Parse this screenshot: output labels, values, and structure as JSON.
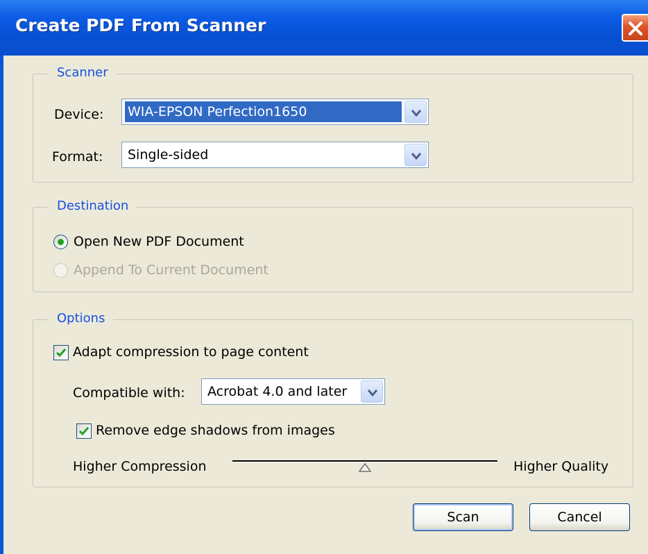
{
  "window": {
    "title": "Create PDF From Scanner"
  },
  "scanner": {
    "legend": "Scanner",
    "device_label": "Device:",
    "device_value": "WIA-EPSON Perfection1650",
    "format_label": "Format:",
    "format_value": "Single-sided"
  },
  "destination": {
    "legend": "Destination",
    "open_new_label": "Open New PDF Document",
    "open_new_selected": true,
    "append_label": "Append To Current Document",
    "append_enabled": false
  },
  "options": {
    "legend": "Options",
    "adapt_compression_label": "Adapt compression to page content",
    "adapt_compression_checked": true,
    "compatible_label": "Compatible with:",
    "compatible_value": "Acrobat 4.0 and later",
    "remove_shadows_label": "Remove edge shadows from images",
    "remove_shadows_checked": true,
    "slider_left_label": "Higher Compression",
    "slider_right_label": "Higher Quality",
    "slider_value_fraction": 0.5
  },
  "buttons": {
    "scan": "Scan",
    "cancel": "Cancel"
  },
  "colors": {
    "titlebar": "#0a4fd0",
    "dialog_bg": "#ece9d8",
    "legend_text": "#1550e0",
    "selection": "#316ac5"
  },
  "icons": {
    "close": "close-icon",
    "dropdown": "chevron-down-icon",
    "check": "checkmark-icon",
    "slider": "slider-thumb-icon"
  }
}
